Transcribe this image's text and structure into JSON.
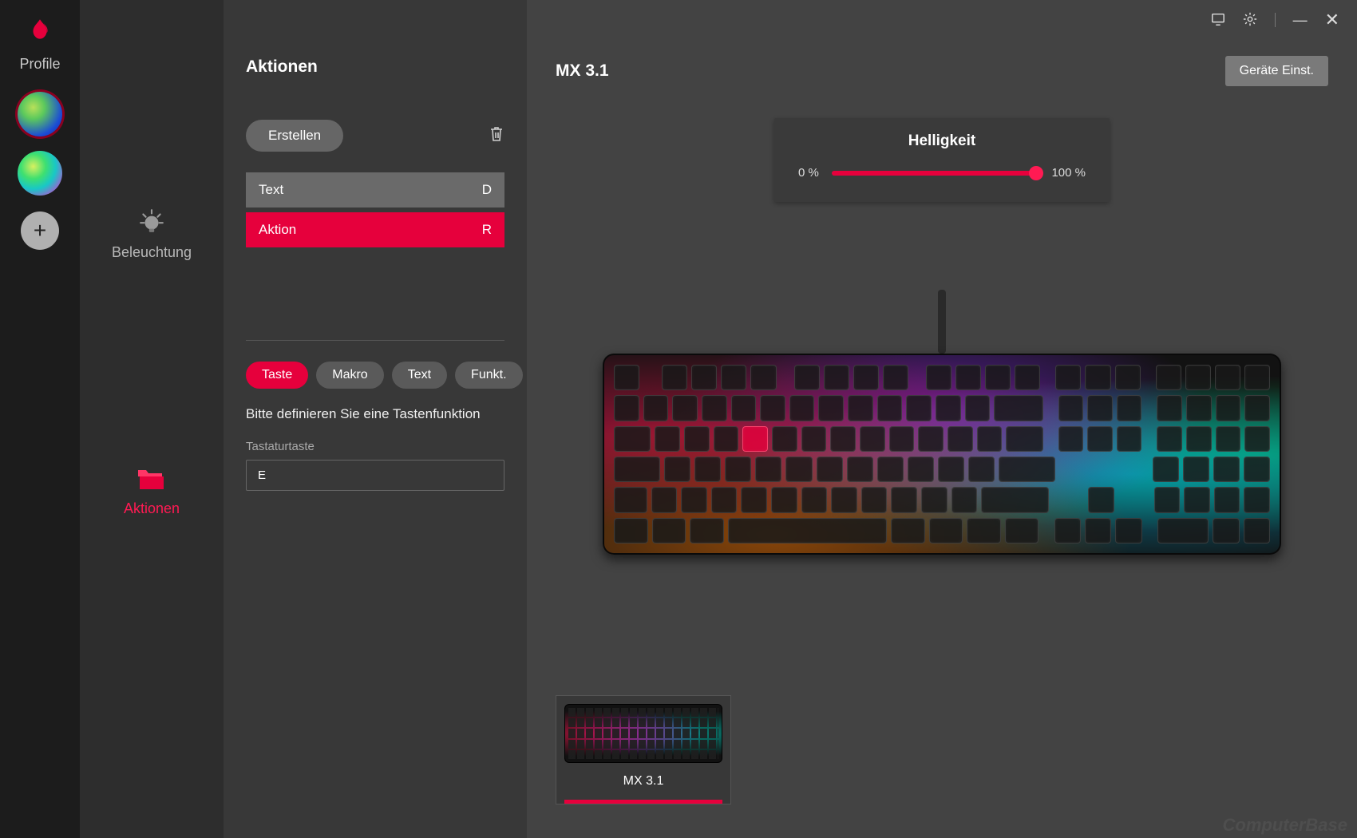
{
  "rail": {
    "label": "Profile",
    "add_glyph": "+"
  },
  "nav": {
    "lighting": {
      "label": "Beleuchtung",
      "active": false
    },
    "actions": {
      "label": "Aktionen",
      "active": true
    }
  },
  "panel": {
    "title": "Aktionen",
    "create_label": "Erstellen",
    "items": [
      {
        "label": "Text",
        "key": "D",
        "style": "text"
      },
      {
        "label": "Aktion",
        "key": "R",
        "style": "action"
      }
    ],
    "tabs": [
      {
        "label": "Taste",
        "active": true
      },
      {
        "label": "Makro",
        "active": false
      },
      {
        "label": "Text",
        "active": false
      },
      {
        "label": "Funkt.",
        "active": false
      }
    ],
    "hint": "Bitte definieren Sie eine Tastenfunktion",
    "key_field": {
      "label": "Tastaturtaste",
      "value": "E"
    }
  },
  "main": {
    "device_title": "MX 3.1",
    "device_settings_label": "Geräte Einst.",
    "brightness": {
      "title": "Helligkeit",
      "min_label": "0 %",
      "max_label": "100 %",
      "value_pct": 100
    },
    "thumbnail": {
      "label": "MX 3.1"
    }
  },
  "watermark": "ComputerBase"
}
